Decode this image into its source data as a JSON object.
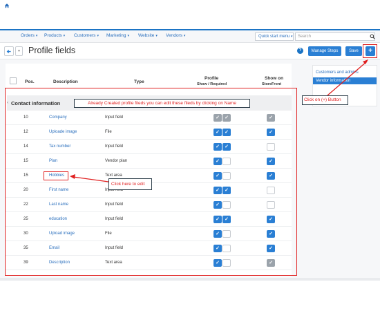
{
  "nav": {
    "items": [
      {
        "label": "Orders"
      },
      {
        "label": "Products"
      },
      {
        "label": "Customers"
      },
      {
        "label": "Marketing"
      },
      {
        "label": "Website"
      },
      {
        "label": "Vendors"
      }
    ],
    "quick_start_menu": "Quick start menu",
    "search_placeholder": "Search"
  },
  "titlebar": {
    "title": "Profile fields",
    "manage_steps": "Manage Steps",
    "save": "Save",
    "add": "+"
  },
  "table": {
    "headers": {
      "pos": "Pos.",
      "description": "Description",
      "type": "Type",
      "profile": "Profile",
      "profile_sub": "Show / Required",
      "storefront": "Show on",
      "storefront_sub": "StoreFront"
    },
    "section_title": "Contact information",
    "rows": [
      {
        "pos": "10",
        "description": "Company",
        "type": "Input field"
      },
      {
        "pos": "12",
        "description": "Uploade image",
        "type": "File"
      },
      {
        "pos": "14",
        "description": "Tax number",
        "type": "Input field"
      },
      {
        "pos": "15",
        "description": "Plan",
        "type": "Vendor plan"
      },
      {
        "pos": "15",
        "description": "Hobbies",
        "type": "Text area"
      },
      {
        "pos": "20",
        "description": "First name",
        "type": "Input field"
      },
      {
        "pos": "22",
        "description": "Last name",
        "type": "Input field"
      },
      {
        "pos": "25",
        "description": "education",
        "type": "Input field"
      },
      {
        "pos": "30",
        "description": "Upload image",
        "type": "File"
      },
      {
        "pos": "35",
        "description": "Email",
        "type": "Input field"
      },
      {
        "pos": "39",
        "description": "Description",
        "type": "Text area"
      }
    ]
  },
  "sidebar": {
    "link": "Customers and admins",
    "active": "Vendor information"
  },
  "annotations": {
    "already_created": "Already Created profile fileds you can edit these fileds by clicking on Name",
    "click_plus": "Click on  (+) Button",
    "click_edit": "Click here to edit"
  },
  "colors": {
    "accent": "#2a7fd4",
    "annotation_red": "#e02020"
  }
}
